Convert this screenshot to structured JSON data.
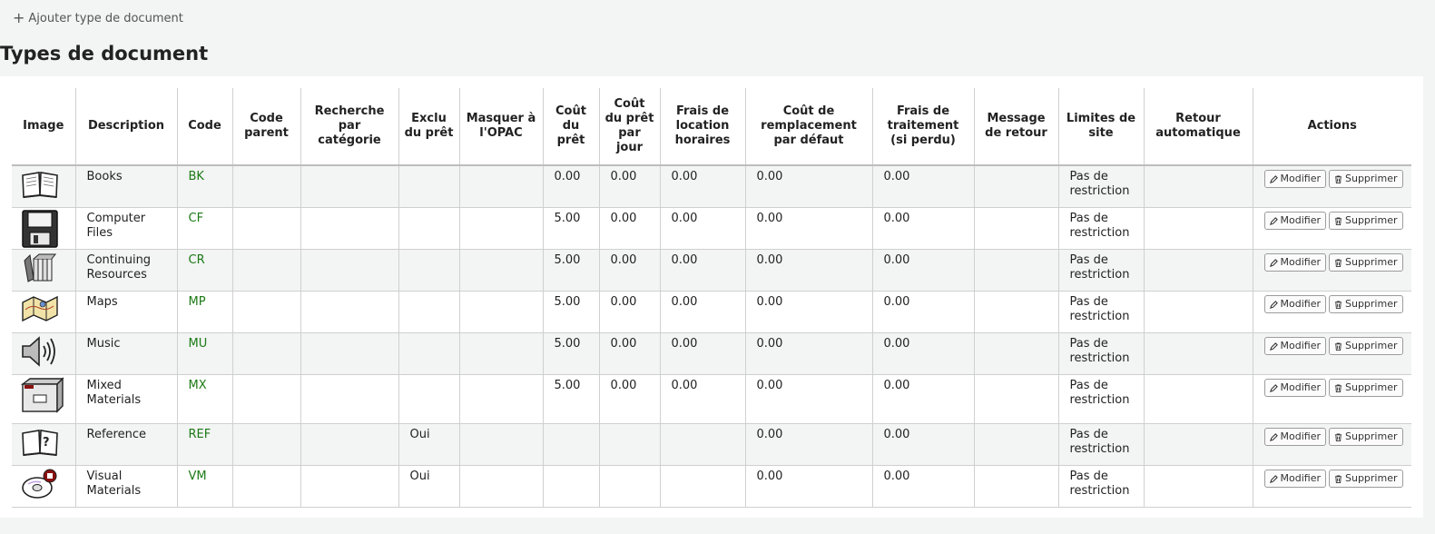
{
  "toolbar": {
    "add_label": "Ajouter type de document"
  },
  "page_title": "Types de document",
  "columns": {
    "image": "Image",
    "description": "Description",
    "code": "Code",
    "parent_code": "Code parent",
    "search_category": "Recherche par catégorie",
    "not_for_loan": "Exclu du prêt",
    "hide_opac": "Masquer à l'OPAC",
    "rental_charge": "Coût du prêt",
    "daily_rental_charge": "Coût du prêt par jour",
    "hourly_rental_charge": "Frais de location horaires",
    "default_replacement_cost": "Coût de remplacement par défaut",
    "processing_fee": "Frais de traitement (si perdu)",
    "checkin_message": "Message de retour",
    "site_limits": "Limites de site",
    "automatic_checkin": "Retour automatique",
    "actions": "Actions"
  },
  "buttons": {
    "edit": "Modifier",
    "delete": "Supprimer"
  },
  "rows": [
    {
      "icon": "book-icon",
      "description": "Books",
      "code": "BK",
      "parent_code": "",
      "search_category": "",
      "not_for_loan": "",
      "hide_opac": "",
      "rental_charge": "0.00",
      "daily_rental_charge": "0.00",
      "hourly_rental_charge": "0.00",
      "default_replacement_cost": "0.00",
      "processing_fee": "0.00",
      "checkin_message": "",
      "site_limits": "Pas de restriction",
      "automatic_checkin": ""
    },
    {
      "icon": "floppy-disk-icon",
      "description": "Computer Files",
      "code": "CF",
      "parent_code": "",
      "search_category": "",
      "not_for_loan": "",
      "hide_opac": "",
      "rental_charge": "5.00",
      "daily_rental_charge": "0.00",
      "hourly_rental_charge": "0.00",
      "default_replacement_cost": "0.00",
      "processing_fee": "0.00",
      "checkin_message": "",
      "site_limits": "Pas de restriction",
      "automatic_checkin": ""
    },
    {
      "icon": "journals-icon",
      "description": "Continuing Resources",
      "code": "CR",
      "parent_code": "",
      "search_category": "",
      "not_for_loan": "",
      "hide_opac": "",
      "rental_charge": "5.00",
      "daily_rental_charge": "0.00",
      "hourly_rental_charge": "0.00",
      "default_replacement_cost": "0.00",
      "processing_fee": "0.00",
      "checkin_message": "",
      "site_limits": "Pas de restriction",
      "automatic_checkin": ""
    },
    {
      "icon": "map-icon",
      "description": "Maps",
      "code": "MP",
      "parent_code": "",
      "search_category": "",
      "not_for_loan": "",
      "hide_opac": "",
      "rental_charge": "5.00",
      "daily_rental_charge": "0.00",
      "hourly_rental_charge": "0.00",
      "default_replacement_cost": "0.00",
      "processing_fee": "0.00",
      "checkin_message": "",
      "site_limits": "Pas de restriction",
      "automatic_checkin": ""
    },
    {
      "icon": "speaker-icon",
      "description": "Music",
      "code": "MU",
      "parent_code": "",
      "search_category": "",
      "not_for_loan": "",
      "hide_opac": "",
      "rental_charge": "5.00",
      "daily_rental_charge": "0.00",
      "hourly_rental_charge": "0.00",
      "default_replacement_cost": "0.00",
      "processing_fee": "0.00",
      "checkin_message": "",
      "site_limits": "Pas de restriction",
      "automatic_checkin": ""
    },
    {
      "icon": "box-icon",
      "description": "Mixed Materials",
      "code": "MX",
      "parent_code": "",
      "search_category": "",
      "not_for_loan": "",
      "hide_opac": "",
      "rental_charge": "5.00",
      "daily_rental_charge": "0.00",
      "hourly_rental_charge": "0.00",
      "default_replacement_cost": "0.00",
      "processing_fee": "0.00",
      "checkin_message": "",
      "site_limits": "Pas de restriction",
      "automatic_checkin": ""
    },
    {
      "icon": "book-question-icon",
      "description": "Reference",
      "code": "REF",
      "parent_code": "",
      "search_category": "",
      "not_for_loan": "Oui",
      "hide_opac": "",
      "rental_charge": "",
      "daily_rental_charge": "",
      "hourly_rental_charge": "",
      "default_replacement_cost": "0.00",
      "processing_fee": "0.00",
      "checkin_message": "",
      "site_limits": "Pas de restriction",
      "automatic_checkin": ""
    },
    {
      "icon": "cd-film-icon",
      "description": "Visual Materials",
      "code": "VM",
      "parent_code": "",
      "search_category": "",
      "not_for_loan": "Oui",
      "hide_opac": "",
      "rental_charge": "",
      "daily_rental_charge": "",
      "hourly_rental_charge": "",
      "default_replacement_cost": "0.00",
      "processing_fee": "0.00",
      "checkin_message": "",
      "site_limits": "Pas de restriction",
      "automatic_checkin": ""
    }
  ]
}
